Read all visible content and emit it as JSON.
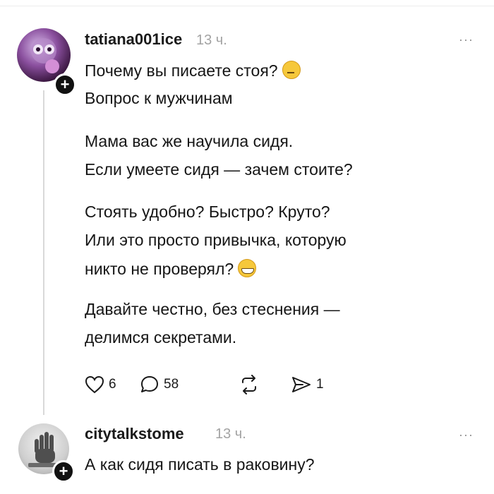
{
  "post": {
    "username": "tatiana001ice",
    "time": "13 ч.",
    "more": "···",
    "lines": [
      "Почему вы писаете стоя?",
      "Вопрос к мужчинам",
      "Мама вас же научила сидя.",
      "Если умеете сидя — зачем стоите?",
      "Стоять удобно? Быстро? Круто?",
      "Или это просто привычка, которую",
      "никто не проверял?",
      "Давайте честно, без стеснения —",
      "делимся секретами."
    ],
    "emoji": [
      "thinking-face-emoji",
      "grinning-face-emoji"
    ],
    "actions": {
      "likes": "6",
      "comments": "58",
      "reposts": "",
      "shares": "1"
    }
  },
  "reply": {
    "username": "citytalkstome",
    "time": "13 ч.",
    "more": "···",
    "text": "А как сидя писать в раковину?"
  }
}
